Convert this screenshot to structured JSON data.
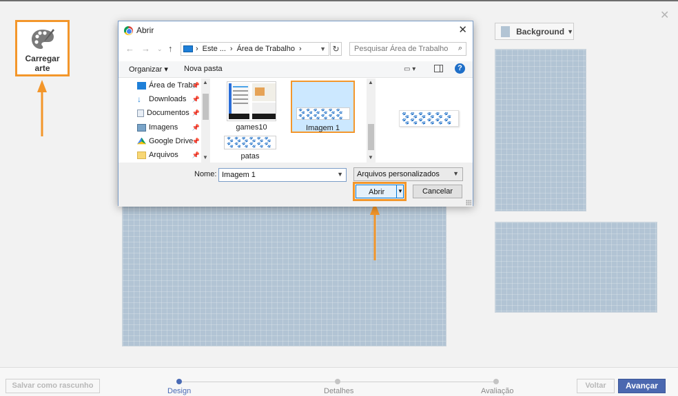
{
  "app": {
    "upload_label": "Carregar arte",
    "background_label": "Background",
    "background_swatch_color": "#b2c4d4",
    "accent_color": "#f3962a"
  },
  "dialog": {
    "title": "Abrir",
    "breadcrumb": [
      "Este ...",
      "Área de Trabalho"
    ],
    "search_placeholder": "Pesquisar Área de Trabalho",
    "toolbar": {
      "organize_label": "Organizar",
      "new_folder_label": "Nova pasta",
      "help_label": "?"
    },
    "sidebar_items": [
      {
        "label": "Área de Traba",
        "icon": "desktop-icon"
      },
      {
        "label": "Downloads",
        "icon": "download-icon"
      },
      {
        "label": "Documentos",
        "icon": "document-icon"
      },
      {
        "label": "Imagens",
        "icon": "image-icon"
      },
      {
        "label": "Google Drive",
        "icon": "google-drive-icon"
      },
      {
        "label": "Arquivos",
        "icon": "folder-icon"
      }
    ],
    "files": [
      {
        "name": "games10"
      },
      {
        "name": "Imagem 1",
        "selected": true
      },
      {
        "name": "patas"
      }
    ],
    "name_label": "Nome:",
    "file_name_value": "Imagem 1",
    "file_type_value": "Arquivos personalizados",
    "open_label": "Abrir",
    "cancel_label": "Cancelar"
  },
  "footer": {
    "save_draft_label": "Salvar como rascunho",
    "steps": [
      {
        "label": "Design",
        "active": true
      },
      {
        "label": "Detalhes",
        "active": false
      },
      {
        "label": "Avaliação",
        "active": false
      }
    ],
    "back_label": "Voltar",
    "next_label": "Avançar"
  }
}
